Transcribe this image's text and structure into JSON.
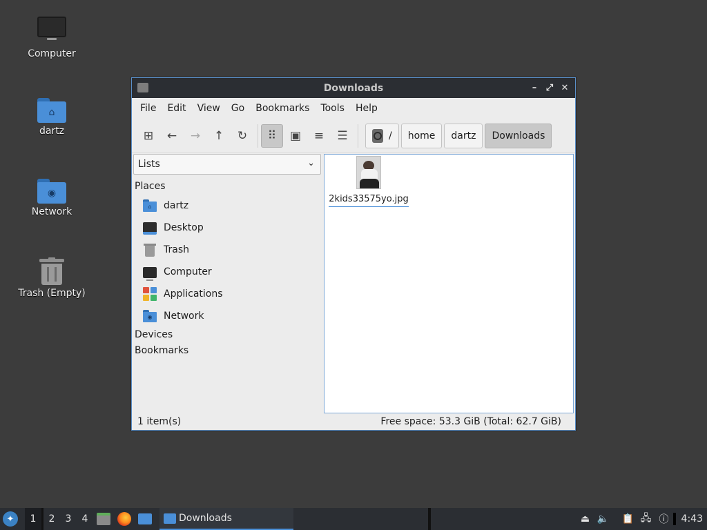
{
  "desktop": {
    "icons": [
      {
        "label": "Computer"
      },
      {
        "label": "dartz"
      },
      {
        "label": "Network"
      },
      {
        "label": "Trash (Empty)"
      }
    ]
  },
  "window": {
    "title": "Downloads",
    "controls": {
      "minimize": "–",
      "maximize": "⤢",
      "close": "✕"
    }
  },
  "menubar": {
    "items": [
      "File",
      "Edit",
      "View",
      "Go",
      "Bookmarks",
      "Tools",
      "Help"
    ]
  },
  "toolbar": {
    "icons": [
      "new-tab-icon",
      "back-icon",
      "forward-icon",
      "up-icon",
      "reload-icon",
      "icon-view-icon",
      "thumbnail-view-icon",
      "compact-view-icon",
      "detailed-list-icon"
    ],
    "path": {
      "root": "/",
      "segments": [
        "home",
        "dartz",
        "Downloads"
      ]
    }
  },
  "sidepane": {
    "mode": "Lists",
    "places_header": "Places",
    "places": [
      {
        "label": "dartz",
        "icon": "home-folder-icon"
      },
      {
        "label": "Desktop",
        "icon": "desktop-icon"
      },
      {
        "label": "Trash",
        "icon": "trash-icon"
      },
      {
        "label": "Computer",
        "icon": "computer-icon"
      },
      {
        "label": "Applications",
        "icon": "applications-icon"
      },
      {
        "label": "Network",
        "icon": "network-folder-icon"
      }
    ],
    "devices_header": "Devices",
    "bookmarks_header": "Bookmarks"
  },
  "files": [
    {
      "name": "2kids33575yo.jpg"
    }
  ],
  "status": {
    "count": "1 item(s)",
    "free_space": "Free space: 53.3 GiB (Total: 62.7 GiB)"
  },
  "taskbar": {
    "workspaces": [
      "1",
      "2",
      "3",
      "4"
    ],
    "active_workspace": "1",
    "task_label": "Downloads",
    "clock": "4:43"
  },
  "colors": {
    "accent": "#4a8fd8",
    "titlebar": "#2b2e33",
    "desktop": "#3c3c3c"
  }
}
